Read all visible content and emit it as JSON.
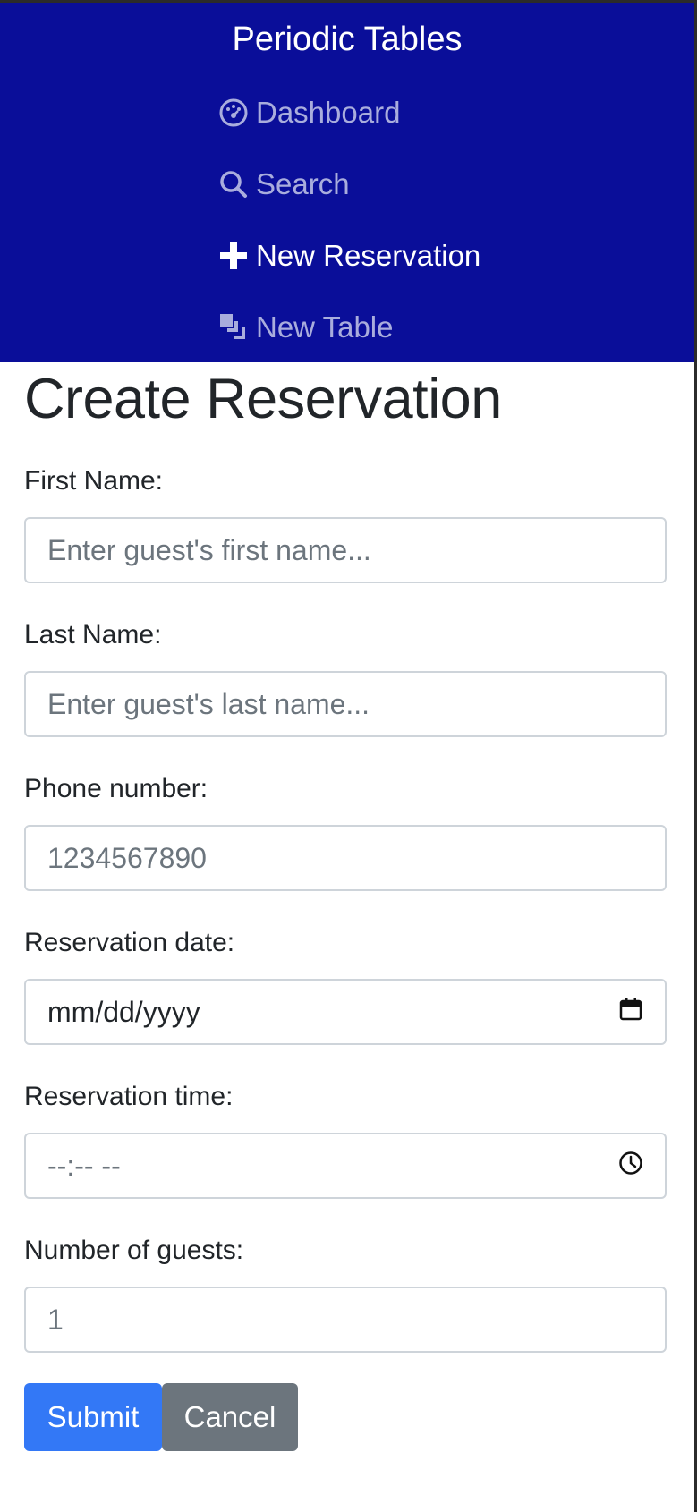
{
  "nav": {
    "brand": "Periodic Tables",
    "items": [
      {
        "label": "Dashboard",
        "icon": "dashboard-icon",
        "active": false
      },
      {
        "label": "Search",
        "icon": "search-icon",
        "active": false
      },
      {
        "label": "New Reservation",
        "icon": "plus-icon",
        "active": true
      },
      {
        "label": "New Table",
        "icon": "layers-icon",
        "active": false
      }
    ]
  },
  "page": {
    "title": "Create Reservation"
  },
  "form": {
    "first_name": {
      "label": "First Name:",
      "placeholder": "Enter guest's first name..."
    },
    "last_name": {
      "label": "Last Name:",
      "placeholder": "Enter guest's last name..."
    },
    "phone": {
      "label": "Phone number:",
      "placeholder": "1234567890"
    },
    "date": {
      "label": "Reservation date:",
      "value": "mm/dd/yyyy",
      "icon": "calendar-icon"
    },
    "time": {
      "label": "Reservation time:",
      "value": "--:-- --",
      "icon": "clock-icon"
    },
    "guests": {
      "label": "Number of guests:",
      "placeholder": "1"
    },
    "submit_label": "Submit",
    "cancel_label": "Cancel"
  },
  "colors": {
    "nav_bg": "#0a0e99",
    "submit": "#3378f6",
    "cancel": "#6c757d"
  }
}
